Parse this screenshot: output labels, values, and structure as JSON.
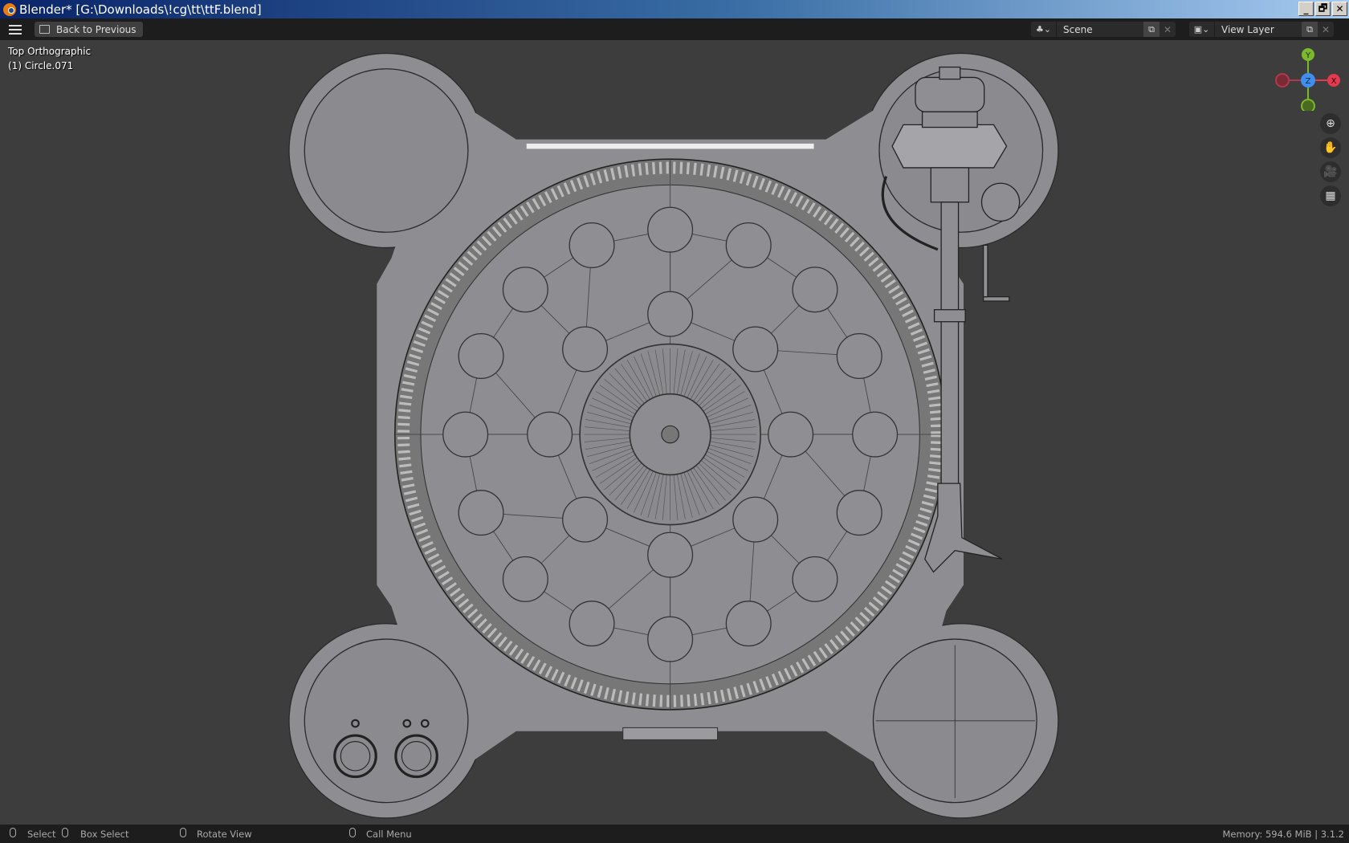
{
  "window": {
    "title": "Blender* [G:\\Downloads\\!cg\\tt\\ttF.blend]",
    "minimize": "_",
    "restore": "🗗",
    "close": "✕"
  },
  "header": {
    "back_label": "Back to Previous",
    "scene": "Scene",
    "view_layer": "View Layer"
  },
  "viewport": {
    "view_name": "Top Orthographic",
    "object": "(1) Circle.071"
  },
  "gizmo": {
    "x": "X",
    "y": "Y",
    "z": "Z",
    "colors": {
      "x": "#e33a4f",
      "y": "#7ab929",
      "z": "#3f8ff2"
    }
  },
  "navigation": {
    "zoom": "zoom-icon",
    "pan": "hand-icon",
    "camera": "camera-icon",
    "ortho": "grid-icon"
  },
  "status": {
    "select": "Select",
    "box_select": "Box Select",
    "rotate": "Rotate View",
    "call_menu": "Call Menu",
    "memory": "Memory: 594.6 MiB | 3.1.2"
  }
}
